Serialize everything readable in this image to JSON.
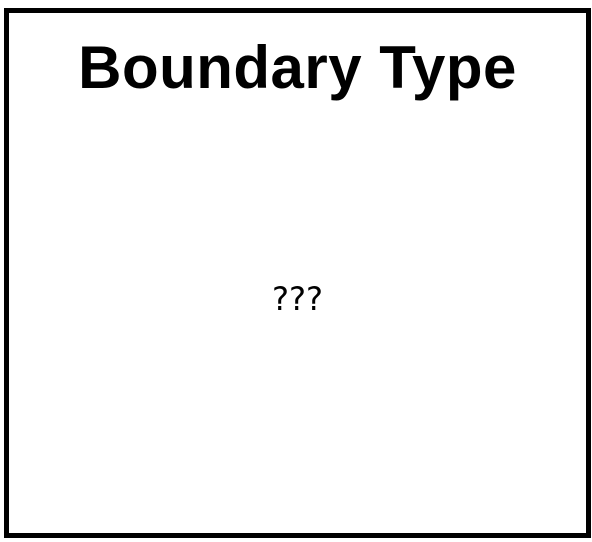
{
  "card": {
    "title": "Boundary Type",
    "value": "???"
  },
  "colors": {
    "border": "#000000",
    "background": "#ffffff",
    "text": "#000000"
  }
}
